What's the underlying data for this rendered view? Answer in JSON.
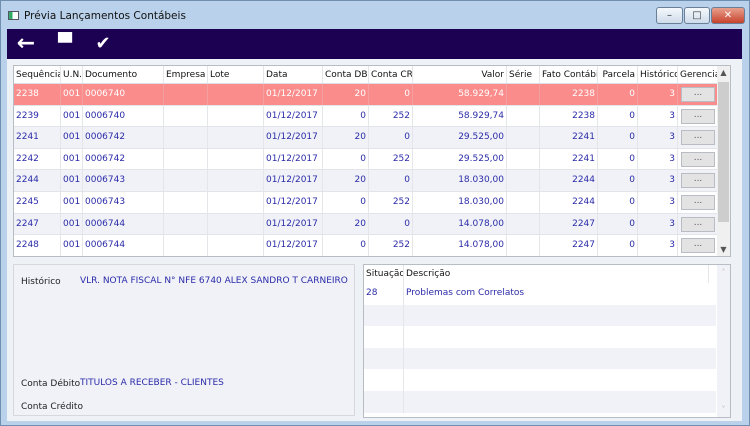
{
  "window": {
    "title": "Prévia Lançamentos Contábeis",
    "min": "–",
    "max": "□",
    "close": "✕"
  },
  "toolbar": {
    "back_icon": "←",
    "print_icon": "▀",
    "confirm_icon": "✔"
  },
  "grid": {
    "columns": [
      "Sequência",
      "U.N.",
      "Documento",
      "Empresa",
      "Lote",
      "Data",
      "Conta DB",
      "Conta CR",
      "Valor",
      "Série",
      "Fato Contábil",
      "Parcela",
      "Histórico",
      "Gerencial"
    ],
    "button_label": "...",
    "rows": [
      [
        "2238",
        "001",
        "0006740",
        "",
        "",
        "01/12/2017",
        "20",
        "0",
        "58.929,74",
        "",
        "2238",
        "0",
        "3"
      ],
      [
        "2239",
        "001",
        "0006740",
        "",
        "",
        "01/12/2017",
        "0",
        "252",
        "58.929,74",
        "",
        "2238",
        "0",
        "3"
      ],
      [
        "2241",
        "001",
        "0006742",
        "",
        "",
        "01/12/2017",
        "20",
        "0",
        "29.525,00",
        "",
        "2241",
        "0",
        "3"
      ],
      [
        "2242",
        "001",
        "0006742",
        "",
        "",
        "01/12/2017",
        "0",
        "252",
        "29.525,00",
        "",
        "2241",
        "0",
        "3"
      ],
      [
        "2244",
        "001",
        "0006743",
        "",
        "",
        "01/12/2017",
        "20",
        "0",
        "18.030,00",
        "",
        "2244",
        "0",
        "3"
      ],
      [
        "2245",
        "001",
        "0006743",
        "",
        "",
        "01/12/2017",
        "0",
        "252",
        "18.030,00",
        "",
        "2244",
        "0",
        "3"
      ],
      [
        "2247",
        "001",
        "0006744",
        "",
        "",
        "01/12/2017",
        "20",
        "0",
        "14.078,00",
        "",
        "2247",
        "0",
        "3"
      ],
      [
        "2248",
        "001",
        "0006744",
        "",
        "",
        "01/12/2017",
        "0",
        "252",
        "14.078,00",
        "",
        "2247",
        "0",
        "3"
      ]
    ],
    "selected_row": 0
  },
  "details": {
    "historico_label": "Histórico",
    "historico_value": "VLR. NOTA FISCAL N° NFE 6740 ALEX SANDRO T CARNEIRO",
    "conta_debito_label": "Conta Débito",
    "conta_debito_value": "TITULOS A RECEBER - CLIENTES",
    "conta_credito_label": "Conta Crédito"
  },
  "situacao": {
    "columns": [
      "Situação",
      "Descrição"
    ],
    "rows": [
      [
        "28",
        "Problemas com Correlatos"
      ]
    ]
  },
  "colors": {
    "toolbar": "#1c0052",
    "selected_row": "#fb8c8c",
    "value_text": "#2b2ba8"
  }
}
